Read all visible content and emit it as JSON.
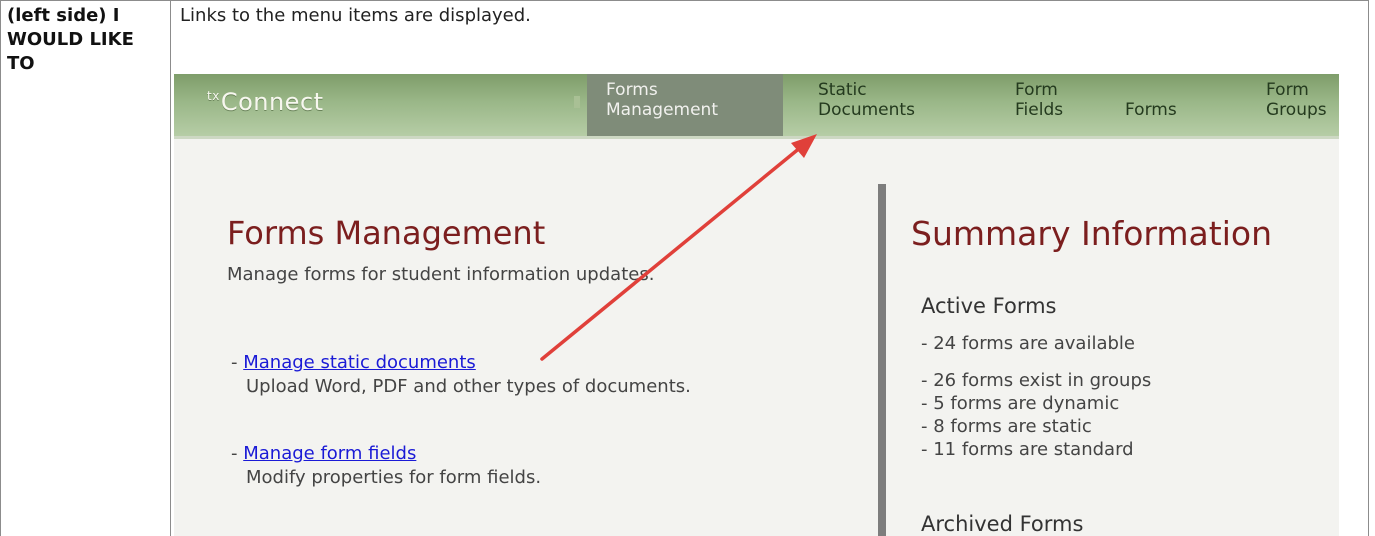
{
  "left": {
    "text": "(left side) I WOULD LIKE TO"
  },
  "intro": "Links to the menu items are displayed.",
  "logo": {
    "sup": "tx",
    "name": "Connect"
  },
  "nav": [
    {
      "l1": "Forms",
      "l2": "Management"
    },
    {
      "l1": "Static",
      "l2": "Documents"
    },
    {
      "l1": "Form",
      "l2": "Fields"
    },
    {
      "l1": "",
      "l2": "Forms"
    },
    {
      "l1": "Form",
      "l2": "Groups"
    }
  ],
  "main": {
    "title": "Forms Management",
    "subtitle": "Manage forms for student information updates.",
    "links": [
      {
        "prefix": "- ",
        "label": "Manage static documents",
        "desc": "Upload Word, PDF and other types of documents."
      },
      {
        "prefix": "- ",
        "label": "Manage form fields",
        "desc": "Modify properties for form fields."
      }
    ]
  },
  "summary": {
    "title": "Summary Information",
    "active_head": "Active Forms",
    "active": [
      "- 24 forms are available",
      "- 26 forms exist in groups",
      "- 5 forms are dynamic",
      "- 8 forms are static",
      "- 11 forms are standard"
    ],
    "archived_head": "Archived Forms"
  },
  "colors": {
    "accent_title": "#7b1e1e",
    "nav_green": "#9ab788",
    "nav_active": "#7f8c79",
    "link": "#1a1ad6",
    "arrow": "#e0403a"
  }
}
